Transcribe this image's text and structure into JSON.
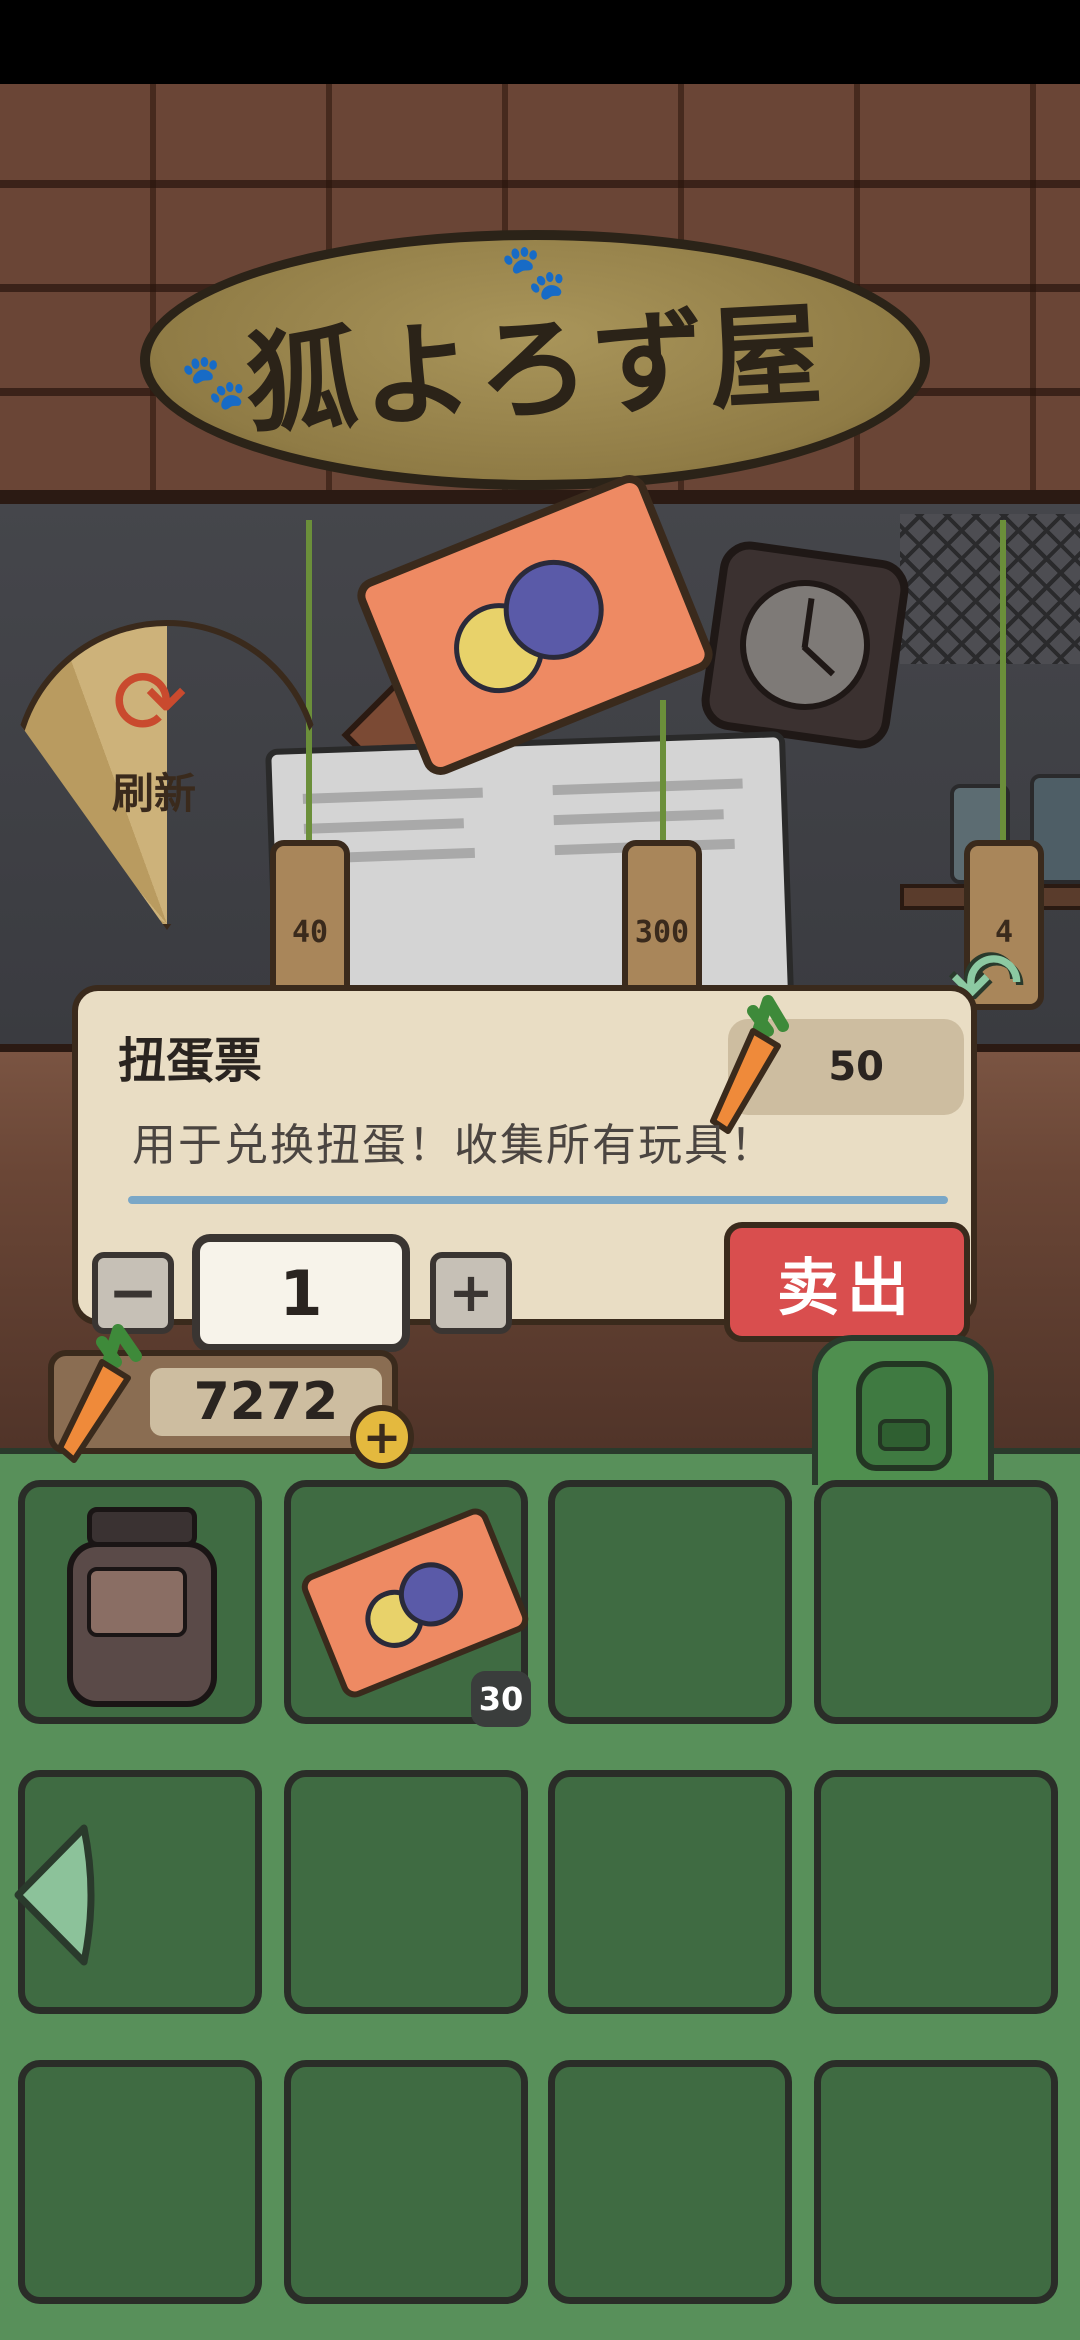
{
  "shop": {
    "sign_text": "狐よろず屋",
    "refresh_label": "刷新",
    "price_tags": [
      "40",
      "300",
      "4"
    ]
  },
  "item": {
    "name": "扭蛋票",
    "description": "用于兑换扭蛋！收集所有玩具！",
    "price": "50"
  },
  "quantity": {
    "minus_label": "−",
    "value": "1",
    "plus_label": "+"
  },
  "sell_button_label": "卖出",
  "balance": {
    "carrots": "7272",
    "add_label": "+"
  },
  "inventory": {
    "slots": [
      {
        "item": "coffee-jar",
        "count": ""
      },
      {
        "item": "gacha-ticket",
        "count": "30"
      },
      {
        "item": "",
        "count": ""
      },
      {
        "item": "",
        "count": ""
      },
      {
        "item": "",
        "count": ""
      },
      {
        "item": "",
        "count": ""
      },
      {
        "item": "",
        "count": ""
      },
      {
        "item": "",
        "count": ""
      },
      {
        "item": "",
        "count": ""
      },
      {
        "item": "",
        "count": ""
      },
      {
        "item": "",
        "count": ""
      },
      {
        "item": "",
        "count": ""
      }
    ]
  },
  "colors": {
    "inventory_bg": "#58905a",
    "slot_bg": "#3f6b42",
    "sell_button": "#d94e4e",
    "panel_bg": "#e9ddc4"
  }
}
